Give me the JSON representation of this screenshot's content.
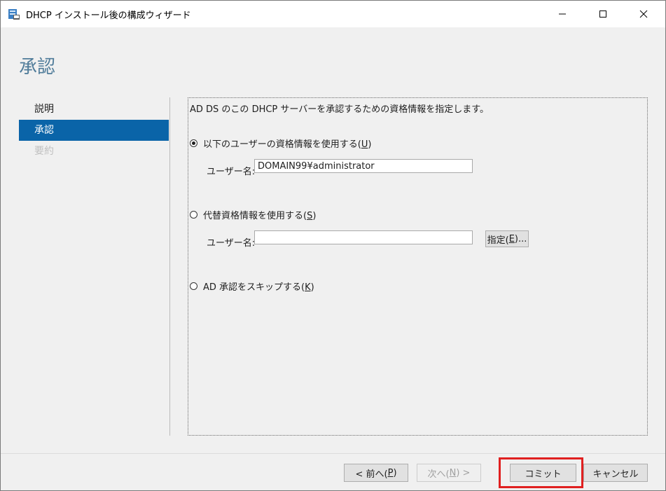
{
  "window": {
    "title": "DHCP インストール後の構成ウィザード",
    "minimize_icon": "minimize-icon",
    "maximize_icon": "maximize-icon",
    "close_icon": "close-icon"
  },
  "page": {
    "title": "承認"
  },
  "nav": {
    "items": [
      {
        "label": "説明",
        "state": "normal"
      },
      {
        "label": "承認",
        "state": "active"
      },
      {
        "label": "要約",
        "state": "disabled"
      }
    ]
  },
  "main": {
    "description": "AD DS のこの DHCP サーバーを承認するための資格情報を指定します。",
    "option_current": {
      "label": "以下のユーザーの資格情報を使用する(",
      "accel": "U",
      "label_end": ")",
      "checked": true
    },
    "username_label_1": "ユーザー名:",
    "username_value_1": "DOMAIN99¥administrator",
    "option_alternate": {
      "label": "代替資格情報を使用する(",
      "accel": "S",
      "label_end": ")",
      "checked": false
    },
    "username_label_2": "ユーザー名:",
    "username_value_2": "",
    "specify_button": {
      "label": "指定(",
      "accel": "E",
      "label_end": ")..."
    },
    "option_skip": {
      "label": "AD 承認をスキップする(",
      "accel": "K",
      "label_end": ")",
      "checked": false
    }
  },
  "footer": {
    "prev": {
      "label": "< 前へ(",
      "accel": "P",
      "label_end": ")"
    },
    "next": {
      "label": "次へ(",
      "accel": "N",
      "label_end": ") >"
    },
    "commit": "コミット",
    "cancel": "キャンセル"
  },
  "colors": {
    "accent": "#0a64a8",
    "title_color": "#507c9a",
    "highlight": "#e02020"
  }
}
